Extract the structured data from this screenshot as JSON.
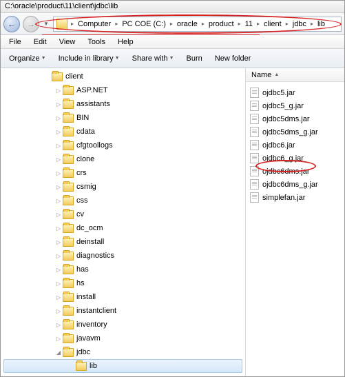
{
  "window": {
    "title": "C:\\oracle\\product\\11\\client\\jdbc\\lib"
  },
  "breadcrumb": {
    "segments": [
      "Computer",
      "PC COE (C:)",
      "oracle",
      "product",
      "11",
      "client",
      "jdbc",
      "lib"
    ]
  },
  "menu": {
    "file": "File",
    "edit": "Edit",
    "view": "View",
    "tools": "Tools",
    "help": "Help"
  },
  "toolbar": {
    "organize": "Organize",
    "include": "Include in library",
    "share": "Share with",
    "burn": "Burn",
    "newfolder": "New folder"
  },
  "tree": {
    "root": "client",
    "children": [
      "ASP.NET",
      "assistants",
      "BIN",
      "cdata",
      "cfgtoollogs",
      "clone",
      "crs",
      "csmig",
      "css",
      "cv",
      "dc_ocm",
      "deinstall",
      "diagnostics",
      "has",
      "hs",
      "install",
      "instantclient",
      "inventory",
      "javavm",
      "jdbc"
    ],
    "selected_child": "lib"
  },
  "files": {
    "header_name": "Name",
    "items": [
      "ojdbc5.jar",
      "ojdbc5_g.jar",
      "ojdbc5dms.jar",
      "ojdbc5dms_g.jar",
      "ojdbc6.jar",
      "ojdbc6_g.jar",
      "ojdbc6dms.jar",
      "ojdbc6dms_g.jar",
      "simplefan.jar"
    ]
  }
}
